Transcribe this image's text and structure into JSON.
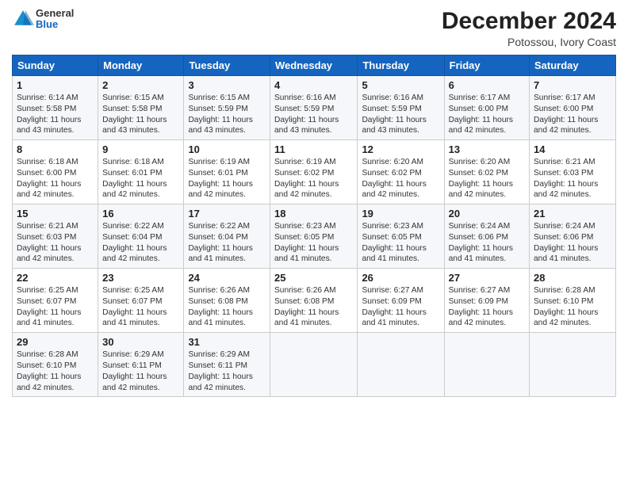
{
  "header": {
    "logo": {
      "general": "General",
      "blue": "Blue"
    },
    "title": "December 2024",
    "location": "Potossou, Ivory Coast"
  },
  "weekdays": [
    "Sunday",
    "Monday",
    "Tuesday",
    "Wednesday",
    "Thursday",
    "Friday",
    "Saturday"
  ],
  "weeks": [
    [
      {
        "day": "1",
        "info": "Sunrise: 6:14 AM\nSunset: 5:58 PM\nDaylight: 11 hours and 43 minutes."
      },
      {
        "day": "2",
        "info": "Sunrise: 6:15 AM\nSunset: 5:58 PM\nDaylight: 11 hours and 43 minutes."
      },
      {
        "day": "3",
        "info": "Sunrise: 6:15 AM\nSunset: 5:59 PM\nDaylight: 11 hours and 43 minutes."
      },
      {
        "day": "4",
        "info": "Sunrise: 6:16 AM\nSunset: 5:59 PM\nDaylight: 11 hours and 43 minutes."
      },
      {
        "day": "5",
        "info": "Sunrise: 6:16 AM\nSunset: 5:59 PM\nDaylight: 11 hours and 43 minutes."
      },
      {
        "day": "6",
        "info": "Sunrise: 6:17 AM\nSunset: 6:00 PM\nDaylight: 11 hours and 42 minutes."
      },
      {
        "day": "7",
        "info": "Sunrise: 6:17 AM\nSunset: 6:00 PM\nDaylight: 11 hours and 42 minutes."
      }
    ],
    [
      {
        "day": "8",
        "info": "Sunrise: 6:18 AM\nSunset: 6:00 PM\nDaylight: 11 hours and 42 minutes."
      },
      {
        "day": "9",
        "info": "Sunrise: 6:18 AM\nSunset: 6:01 PM\nDaylight: 11 hours and 42 minutes."
      },
      {
        "day": "10",
        "info": "Sunrise: 6:19 AM\nSunset: 6:01 PM\nDaylight: 11 hours and 42 minutes."
      },
      {
        "day": "11",
        "info": "Sunrise: 6:19 AM\nSunset: 6:02 PM\nDaylight: 11 hours and 42 minutes."
      },
      {
        "day": "12",
        "info": "Sunrise: 6:20 AM\nSunset: 6:02 PM\nDaylight: 11 hours and 42 minutes."
      },
      {
        "day": "13",
        "info": "Sunrise: 6:20 AM\nSunset: 6:02 PM\nDaylight: 11 hours and 42 minutes."
      },
      {
        "day": "14",
        "info": "Sunrise: 6:21 AM\nSunset: 6:03 PM\nDaylight: 11 hours and 42 minutes."
      }
    ],
    [
      {
        "day": "15",
        "info": "Sunrise: 6:21 AM\nSunset: 6:03 PM\nDaylight: 11 hours and 42 minutes."
      },
      {
        "day": "16",
        "info": "Sunrise: 6:22 AM\nSunset: 6:04 PM\nDaylight: 11 hours and 42 minutes."
      },
      {
        "day": "17",
        "info": "Sunrise: 6:22 AM\nSunset: 6:04 PM\nDaylight: 11 hours and 41 minutes."
      },
      {
        "day": "18",
        "info": "Sunrise: 6:23 AM\nSunset: 6:05 PM\nDaylight: 11 hours and 41 minutes."
      },
      {
        "day": "19",
        "info": "Sunrise: 6:23 AM\nSunset: 6:05 PM\nDaylight: 11 hours and 41 minutes."
      },
      {
        "day": "20",
        "info": "Sunrise: 6:24 AM\nSunset: 6:06 PM\nDaylight: 11 hours and 41 minutes."
      },
      {
        "day": "21",
        "info": "Sunrise: 6:24 AM\nSunset: 6:06 PM\nDaylight: 11 hours and 41 minutes."
      }
    ],
    [
      {
        "day": "22",
        "info": "Sunrise: 6:25 AM\nSunset: 6:07 PM\nDaylight: 11 hours and 41 minutes."
      },
      {
        "day": "23",
        "info": "Sunrise: 6:25 AM\nSunset: 6:07 PM\nDaylight: 11 hours and 41 minutes."
      },
      {
        "day": "24",
        "info": "Sunrise: 6:26 AM\nSunset: 6:08 PM\nDaylight: 11 hours and 41 minutes."
      },
      {
        "day": "25",
        "info": "Sunrise: 6:26 AM\nSunset: 6:08 PM\nDaylight: 11 hours and 41 minutes."
      },
      {
        "day": "26",
        "info": "Sunrise: 6:27 AM\nSunset: 6:09 PM\nDaylight: 11 hours and 41 minutes."
      },
      {
        "day": "27",
        "info": "Sunrise: 6:27 AM\nSunset: 6:09 PM\nDaylight: 11 hours and 42 minutes."
      },
      {
        "day": "28",
        "info": "Sunrise: 6:28 AM\nSunset: 6:10 PM\nDaylight: 11 hours and 42 minutes."
      }
    ],
    [
      {
        "day": "29",
        "info": "Sunrise: 6:28 AM\nSunset: 6:10 PM\nDaylight: 11 hours and 42 minutes."
      },
      {
        "day": "30",
        "info": "Sunrise: 6:29 AM\nSunset: 6:11 PM\nDaylight: 11 hours and 42 minutes."
      },
      {
        "day": "31",
        "info": "Sunrise: 6:29 AM\nSunset: 6:11 PM\nDaylight: 11 hours and 42 minutes."
      },
      null,
      null,
      null,
      null
    ]
  ]
}
